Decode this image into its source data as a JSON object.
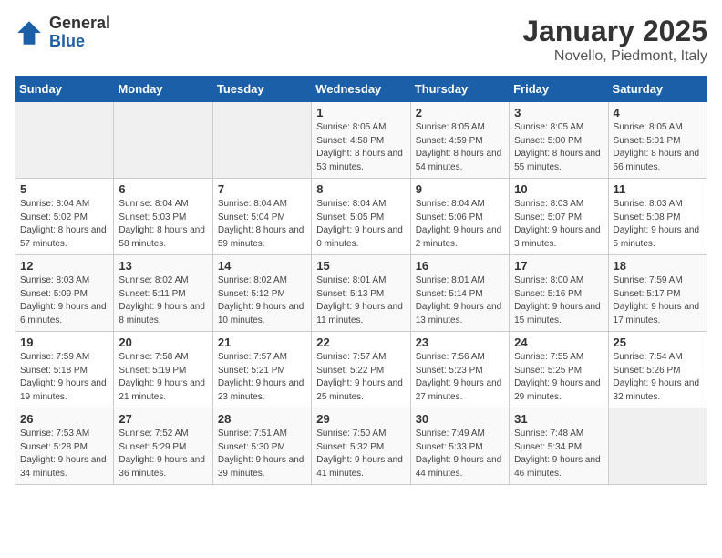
{
  "header": {
    "logo_general": "General",
    "logo_blue": "Blue",
    "title": "January 2025",
    "subtitle": "Novello, Piedmont, Italy"
  },
  "weekdays": [
    "Sunday",
    "Monday",
    "Tuesday",
    "Wednesday",
    "Thursday",
    "Friday",
    "Saturday"
  ],
  "weeks": [
    [
      {
        "day": "",
        "info": ""
      },
      {
        "day": "",
        "info": ""
      },
      {
        "day": "",
        "info": ""
      },
      {
        "day": "1",
        "info": "Sunrise: 8:05 AM\nSunset: 4:58 PM\nDaylight: 8 hours and 53 minutes."
      },
      {
        "day": "2",
        "info": "Sunrise: 8:05 AM\nSunset: 4:59 PM\nDaylight: 8 hours and 54 minutes."
      },
      {
        "day": "3",
        "info": "Sunrise: 8:05 AM\nSunset: 5:00 PM\nDaylight: 8 hours and 55 minutes."
      },
      {
        "day": "4",
        "info": "Sunrise: 8:05 AM\nSunset: 5:01 PM\nDaylight: 8 hours and 56 minutes."
      }
    ],
    [
      {
        "day": "5",
        "info": "Sunrise: 8:04 AM\nSunset: 5:02 PM\nDaylight: 8 hours and 57 minutes."
      },
      {
        "day": "6",
        "info": "Sunrise: 8:04 AM\nSunset: 5:03 PM\nDaylight: 8 hours and 58 minutes."
      },
      {
        "day": "7",
        "info": "Sunrise: 8:04 AM\nSunset: 5:04 PM\nDaylight: 8 hours and 59 minutes."
      },
      {
        "day": "8",
        "info": "Sunrise: 8:04 AM\nSunset: 5:05 PM\nDaylight: 9 hours and 0 minutes."
      },
      {
        "day": "9",
        "info": "Sunrise: 8:04 AM\nSunset: 5:06 PM\nDaylight: 9 hours and 2 minutes."
      },
      {
        "day": "10",
        "info": "Sunrise: 8:03 AM\nSunset: 5:07 PM\nDaylight: 9 hours and 3 minutes."
      },
      {
        "day": "11",
        "info": "Sunrise: 8:03 AM\nSunset: 5:08 PM\nDaylight: 9 hours and 5 minutes."
      }
    ],
    [
      {
        "day": "12",
        "info": "Sunrise: 8:03 AM\nSunset: 5:09 PM\nDaylight: 9 hours and 6 minutes."
      },
      {
        "day": "13",
        "info": "Sunrise: 8:02 AM\nSunset: 5:11 PM\nDaylight: 9 hours and 8 minutes."
      },
      {
        "day": "14",
        "info": "Sunrise: 8:02 AM\nSunset: 5:12 PM\nDaylight: 9 hours and 10 minutes."
      },
      {
        "day": "15",
        "info": "Sunrise: 8:01 AM\nSunset: 5:13 PM\nDaylight: 9 hours and 11 minutes."
      },
      {
        "day": "16",
        "info": "Sunrise: 8:01 AM\nSunset: 5:14 PM\nDaylight: 9 hours and 13 minutes."
      },
      {
        "day": "17",
        "info": "Sunrise: 8:00 AM\nSunset: 5:16 PM\nDaylight: 9 hours and 15 minutes."
      },
      {
        "day": "18",
        "info": "Sunrise: 7:59 AM\nSunset: 5:17 PM\nDaylight: 9 hours and 17 minutes."
      }
    ],
    [
      {
        "day": "19",
        "info": "Sunrise: 7:59 AM\nSunset: 5:18 PM\nDaylight: 9 hours and 19 minutes."
      },
      {
        "day": "20",
        "info": "Sunrise: 7:58 AM\nSunset: 5:19 PM\nDaylight: 9 hours and 21 minutes."
      },
      {
        "day": "21",
        "info": "Sunrise: 7:57 AM\nSunset: 5:21 PM\nDaylight: 9 hours and 23 minutes."
      },
      {
        "day": "22",
        "info": "Sunrise: 7:57 AM\nSunset: 5:22 PM\nDaylight: 9 hours and 25 minutes."
      },
      {
        "day": "23",
        "info": "Sunrise: 7:56 AM\nSunset: 5:23 PM\nDaylight: 9 hours and 27 minutes."
      },
      {
        "day": "24",
        "info": "Sunrise: 7:55 AM\nSunset: 5:25 PM\nDaylight: 9 hours and 29 minutes."
      },
      {
        "day": "25",
        "info": "Sunrise: 7:54 AM\nSunset: 5:26 PM\nDaylight: 9 hours and 32 minutes."
      }
    ],
    [
      {
        "day": "26",
        "info": "Sunrise: 7:53 AM\nSunset: 5:28 PM\nDaylight: 9 hours and 34 minutes."
      },
      {
        "day": "27",
        "info": "Sunrise: 7:52 AM\nSunset: 5:29 PM\nDaylight: 9 hours and 36 minutes."
      },
      {
        "day": "28",
        "info": "Sunrise: 7:51 AM\nSunset: 5:30 PM\nDaylight: 9 hours and 39 minutes."
      },
      {
        "day": "29",
        "info": "Sunrise: 7:50 AM\nSunset: 5:32 PM\nDaylight: 9 hours and 41 minutes."
      },
      {
        "day": "30",
        "info": "Sunrise: 7:49 AM\nSunset: 5:33 PM\nDaylight: 9 hours and 44 minutes."
      },
      {
        "day": "31",
        "info": "Sunrise: 7:48 AM\nSunset: 5:34 PM\nDaylight: 9 hours and 46 minutes."
      },
      {
        "day": "",
        "info": ""
      }
    ]
  ]
}
